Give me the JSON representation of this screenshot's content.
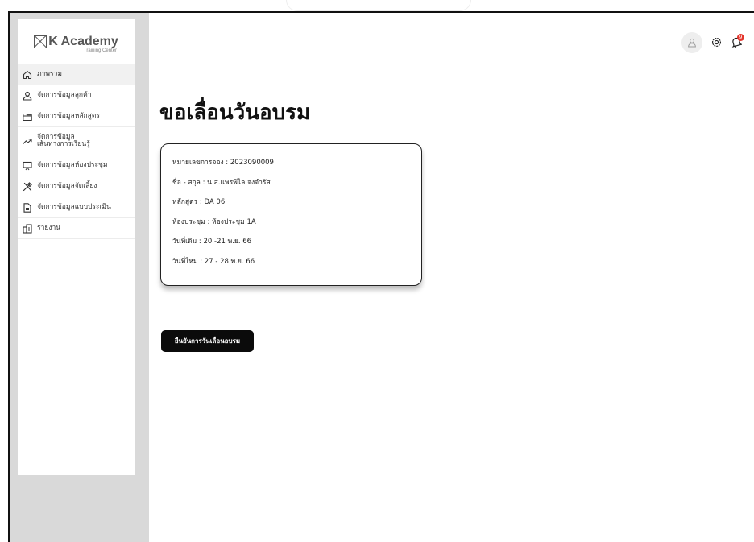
{
  "app": {
    "logo_title": "K Academy",
    "logo_subtitle": "Training Center"
  },
  "sidebar": {
    "items": [
      {
        "label": "ภาพรวม",
        "icon": "home-icon",
        "active": true
      },
      {
        "label": "จัดการข้อมูลลูกค้า",
        "icon": "user-icon"
      },
      {
        "label": "จัดการข้อมูลหลักสูตร",
        "icon": "folder-icon"
      },
      {
        "label": "จัดการข้อมูล\nเส้นทางการเรียนรู้",
        "icon": "trend-icon"
      },
      {
        "label": "จัดการข้อมูลห้องประชุม",
        "icon": "presentation-icon"
      },
      {
        "label": "จัดการข้อมูลจัดเลี้ยง",
        "icon": "utensils-icon"
      },
      {
        "label": "จัดการข้อมูลแบบประเมิน",
        "icon": "document-icon"
      },
      {
        "label": "รายงาน",
        "icon": "building-icon"
      }
    ]
  },
  "header": {
    "icons": [
      "user-icon",
      "gear-icon",
      "bell-icon"
    ],
    "notification_count": "9"
  },
  "main": {
    "title": "ขอเลื่อนวันอบรม",
    "details": [
      "หมายเลขการจอง : 2023090009",
      "ชื่อ - สกุล : น.ส.แพรพิไล จงจำรัส",
      "หลักสูตร : DA 06",
      "ห้องประชุม : ห้องประชุม 1A",
      "วันที่เดิม :  20 -21 พ.ย. 66",
      "วันที่ใหม่ :  27 - 28 พ.ย. 66"
    ],
    "confirm_label": "ยืนยันการวันเลื่อนอบรม"
  },
  "colors": {
    "sidebar_bg": "#d9d9d9",
    "button_bg": "#0b0b0b",
    "badge": "#e4352c"
  }
}
